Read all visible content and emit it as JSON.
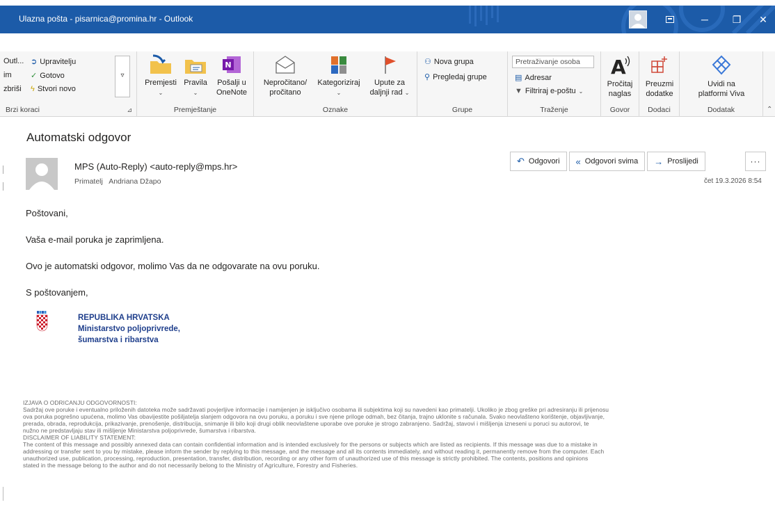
{
  "window": {
    "title": "Ulazna pošta - pisarnica@promina.hr - Outlook",
    "controls": {
      "minimize": "─",
      "restore": "❐",
      "close": "✕"
    }
  },
  "ribbon": {
    "quick_steps": {
      "items": [
        "Outl...",
        "Upravitelju",
        "im",
        "Gotovo",
        "zbriši",
        "Stvori novo"
      ],
      "label": "Brzi koraci"
    },
    "move": {
      "buttons": {
        "move": "Premjesti",
        "rules": "Pravila",
        "onenote_1": "Pošalji u",
        "onenote_2": "OneNote"
      },
      "label": "Premještanje"
    },
    "tags": {
      "buttons": {
        "unread_1": "Nepročitano/",
        "unread_2": "pročitano",
        "categorize": "Kategoriziraj",
        "followup_1": "Upute za",
        "followup_2": "daljnji rad"
      },
      "label": "Oznake"
    },
    "groups": {
      "buttons": {
        "new_group": "Nova grupa",
        "browse_groups": "Pregledaj grupe"
      },
      "label": "Grupe"
    },
    "find": {
      "search_placeholder": "Pretraživanje osoba",
      "address_book": "Adresar",
      "filter": "Filtriraj e-poštu",
      "label": "Traženje"
    },
    "speech": {
      "read_1": "Pročitaj",
      "read_2": "naglas",
      "label": "Govor"
    },
    "addins": {
      "get_1": "Preuzmi",
      "get_2": "dodatke",
      "label": "Dodaci"
    },
    "addin": {
      "viva_1": "Uvidi na",
      "viva_2": "platformi Viva",
      "label": "Dodatak"
    }
  },
  "message": {
    "subject": "Automatski odgovor",
    "sender": "MPS (Auto-Reply) <auto-reply@mps.hr>",
    "recipient_label": "Primatelj",
    "recipient": "Andriana Džapo",
    "date": "čet 19.3.2026 8:54",
    "actions": {
      "reply": "Odgovori",
      "reply_all": "Odgovori svima",
      "forward": "Proslijedi",
      "more": "···"
    },
    "body": {
      "greeting": "Poštovani,",
      "line1": "Vaša e-mail poruka je zaprimljena.",
      "line2": "Ovo je automatski odgovor, molimo Vas da ne odgovarate na ovu poruku.",
      "closing": "S poštovanjem,"
    },
    "signature": {
      "line1": "REPUBLIKA HRVATSKA",
      "line2": "Ministarstvo poljoprivrede,",
      "line3": "šumarstva i ribarstva"
    },
    "disclaimer": {
      "hr_title": "IZJAVA O ODRICANJU ODGOVORNOSTI:",
      "hr_l1": "Sadržaj ove poruke i eventualno priloženih datoteka može sadržavati povjerljive informacije i namijenjen je isključivo osobama ili subjektima koji su navedeni kao primatelji. Ukoliko je zbog greške pri adresiranju ili prijenosu",
      "hr_l2": "ova poruka pogrešno upućena, molimo Vas obavijestite pošiljatelja slanjem odgovora na ovu poruku, a poruku i sve njene priloge odmah, bez čitanja, trajno uklonite s računala. Svako neovlašteno korištenje, objavljivanje,",
      "hr_l3": "prerada, obrada, reprodukcija, prikazivanje, prenošenje, distribucija, snimanje ili bilo koji drugi oblik neovlaštene uporabe ove poruke je strogo zabranjeno. Sadržaj, stavovi i mišljenja izneseni u poruci su autorovi, te",
      "hr_l4": "nužno ne predstavljaju stav ili mišljenje Ministarstva poljoprivrede, šumarstva i ribarstva.",
      "en_title": "DISCLAIMER OF LIABILITY STATEMENT:",
      "en_l1": "The content of this message and possibly annexed data can contain confidential information and is intended exclusively for the persons or subjects which are listed as recipients. If this message was due to a mistake in",
      "en_l2": "addressing or transfer sent to you by mistake, please inform the sender by replying to this message, and the message and all its contents immediately, and without reading it, permanently remove from the computer. Each",
      "en_l3": "unauthorized use, publication, processing, reproduction, presentation, transfer, distribution, recording or any other form of unauthorized use of this message is strictly prohibited. The contents, positions and opinions",
      "en_l4": "stated in the message belong to the author and do not necessarily belong to the Ministry of Agriculture, Forestry and Fisheries."
    }
  },
  "colors": {
    "titlebar": "#1c5ba8",
    "accent": "#1c5ba8",
    "signature": "#1f3f8c"
  }
}
